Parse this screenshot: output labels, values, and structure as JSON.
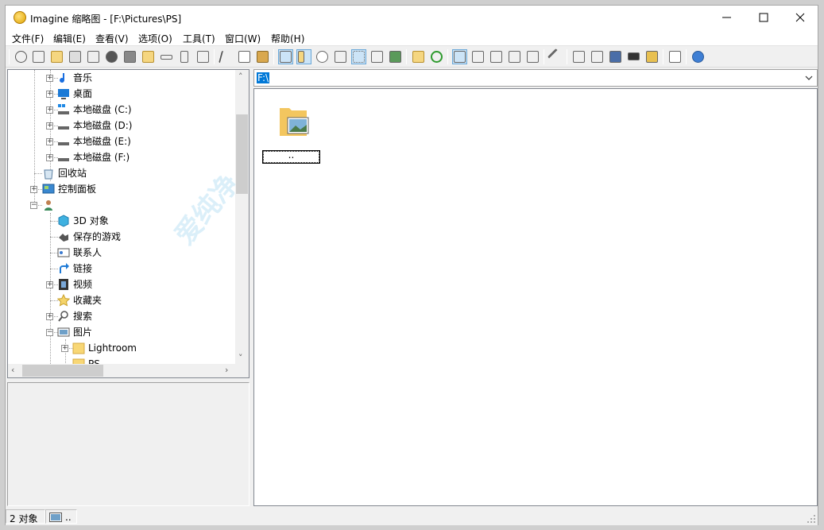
{
  "window": {
    "title": "Imagine 缩略图 - [F:\\Pictures\\PS]",
    "icon": "app-sun-icon",
    "controls": [
      "minimize-icon",
      "maximize-icon",
      "close-icon"
    ]
  },
  "menu": [
    {
      "label": "文件(F)"
    },
    {
      "label": "编辑(E)"
    },
    {
      "label": "查看(V)"
    },
    {
      "label": "选项(O)"
    },
    {
      "label": "工具(T)"
    },
    {
      "label": "窗口(W)"
    },
    {
      "label": "帮助(H)"
    }
  ],
  "tree": {
    "items": [
      {
        "label": "音乐",
        "icon": "music-note-icon"
      },
      {
        "label": "桌面",
        "icon": "desktop-icon"
      },
      {
        "label": "本地磁盘 (C:)",
        "icon": "system-drive-icon"
      },
      {
        "label": "本地磁盘 (D:)",
        "icon": "drive-icon"
      },
      {
        "label": "本地磁盘 (E:)",
        "icon": "drive-icon"
      },
      {
        "label": "本地磁盘 (F:)",
        "icon": "drive-icon"
      },
      {
        "label": "回收站",
        "icon": "recycle-bin-icon"
      },
      {
        "label": "控制面板",
        "icon": "control-panel-icon"
      },
      {
        "label": "",
        "icon": "user-folder-icon"
      },
      {
        "label": "3D 对象",
        "icon": "cube-3d-icon"
      },
      {
        "label": "保存的游戏",
        "icon": "saved-games-icon"
      },
      {
        "label": "联系人",
        "icon": "contacts-icon"
      },
      {
        "label": "链接",
        "icon": "link-arrow-icon"
      },
      {
        "label": "视频",
        "icon": "video-film-icon"
      },
      {
        "label": "收藏夹",
        "icon": "star-icon"
      },
      {
        "label": "搜索",
        "icon": "search-icon"
      },
      {
        "label": "图片",
        "icon": "pictures-icon"
      },
      {
        "label": "Lightroom",
        "icon": "folder-icon"
      },
      {
        "label": "PS",
        "icon": "folder-icon"
      }
    ]
  },
  "address": {
    "value": "F:\\"
  },
  "content": {
    "items": [
      {
        "label": "..",
        "icon": "folder-picture-icon"
      }
    ]
  },
  "status": {
    "count": "2 对象",
    "selected": ".."
  },
  "watermark": "爱纯净",
  "colors": {
    "selection": "#0078d7",
    "toolbar_active": "#cce4f7"
  }
}
